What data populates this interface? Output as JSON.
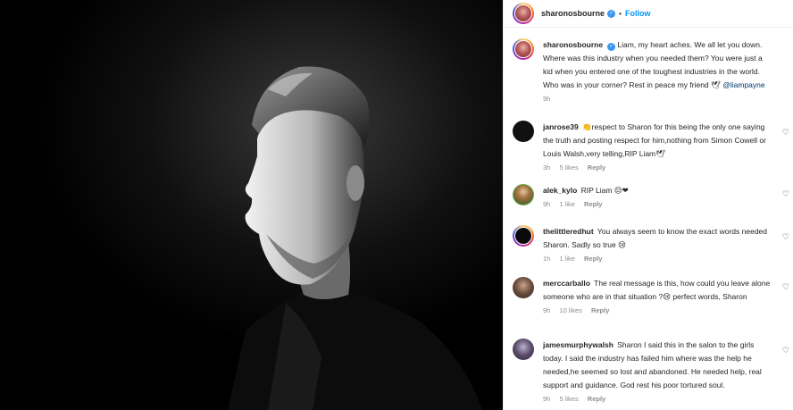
{
  "post": {
    "username": "sharonosbourne",
    "dot": "•",
    "follow_label": "Follow",
    "verified_glyph": "✓",
    "caption_text": "Liam, my heart aches. We all let you down. Where was this industry when you needed them? You were just a kid when you entered one of the toughest industries in the world. Who was in your corner? Rest in peace my friend 🕊",
    "caption_mention": "@liampayne",
    "caption_time": "9h"
  },
  "comments": [
    {
      "username": "janrose39",
      "text": "👏respect to Sharon for this being the only one saying the truth and posting respect for him,nothing from Simon Cowell or Louis Walsh,very telling,RIP Liam🕊",
      "time": "3h",
      "likes": "5 likes",
      "reply": "Reply"
    },
    {
      "username": "alek_kylo",
      "text": "RIP Liam 😔❤",
      "time": "9h",
      "likes": "1 like",
      "reply": "Reply"
    },
    {
      "username": "thelittleredhut",
      "text": "You always seem to know the exact words needed Sharon. Sadly so true 😢",
      "time": "1h",
      "likes": "1 like",
      "reply": "Reply"
    },
    {
      "username": "merccarballo",
      "text": "The real message is this, how could you leave alone someone who are in that situation ?😢 perfect words, Sharon",
      "time": "9h",
      "likes": "10 likes",
      "reply": "Reply"
    },
    {
      "username": "jamesmurphywalsh",
      "text": "Sharon I said this in the salon to the girls today. I said the industry has failed him where was the help he needed,he seemed so lost and abandoned. He needed help, real support and guidance. God rest his poor tortured soul.",
      "time": "9h",
      "likes": "5 likes",
      "reply": "Reply"
    }
  ],
  "icons": {
    "like": "heart-outline-icon"
  },
  "colors": {
    "link": "#0095f6",
    "mention": "#00376b",
    "meta": "#8e8e8e",
    "verified": "#3897f0",
    "like_heart": "#ed4956"
  }
}
